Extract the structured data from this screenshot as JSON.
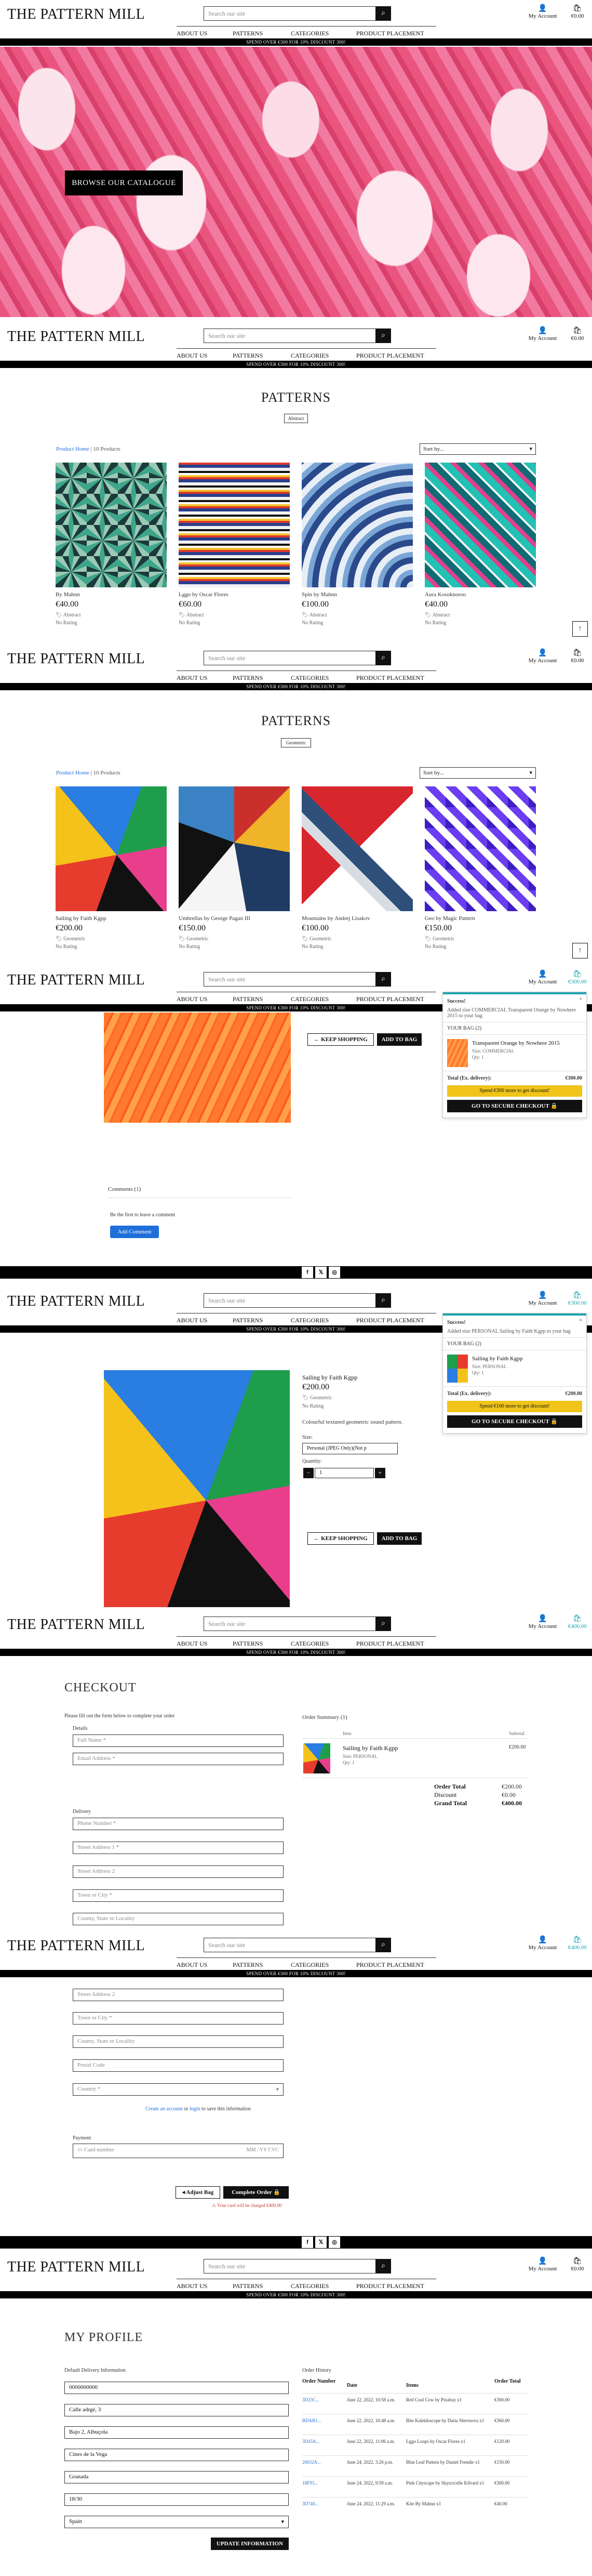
{
  "header": {
    "logo": "THE PATTERN MILL",
    "search_placeholder": "Search our site",
    "account": "My Account",
    "bag_total_empty": "€0.00",
    "bag_total_full": "€300.00",
    "bag_total_checkout": "€400.00",
    "search_icon": "search-icon",
    "account_icon": "user-icon",
    "bag_icon": "shopping-bag-icon"
  },
  "nav": {
    "about": "ABOUT US",
    "patterns": "PATTERNS",
    "categories": "CATEGORIES",
    "placement": "PRODUCT PLACEMENT"
  },
  "banner": "SPEND OVER €300 FOR 10% DISCOUNT 300!",
  "hero": {
    "button": "BROWSE OUR CATALOGUE"
  },
  "listing1": {
    "title": "PATTERNS",
    "tag": "Abstract",
    "home": "Product Home",
    "count": "| 10 Products",
    "sort": "Sort by...",
    "products": [
      {
        "name": "By Mahnn",
        "price": "€40.00",
        "category": "Abstract",
        "rating": "No Rating"
      },
      {
        "name": "Lggo by Oscar Flores",
        "price": "€60.00",
        "category": "Abstract",
        "rating": "No Rating"
      },
      {
        "name": "Spin by Mahnn",
        "price": "€100.00",
        "category": "Abstract",
        "rating": "No Rating"
      },
      {
        "name": "Aura Kosoknoroo",
        "price": "€40.00",
        "category": "Abstract",
        "rating": "No Rating"
      }
    ]
  },
  "listing2": {
    "title": "PATTERNS",
    "tag": "Geometric",
    "home": "Product Home",
    "count": "| 10 Products",
    "sort": "Sort by...",
    "products": [
      {
        "name": "Sailing by Faith Kgpp",
        "price": "€200.00",
        "category": "Geometric",
        "rating": "No Rating"
      },
      {
        "name": "Umbrellas by George Pagan III",
        "price": "€150.00",
        "category": "Geometric",
        "rating": "No Rating"
      },
      {
        "name": "Mountains by Andrej Lisakov",
        "price": "€100.00",
        "category": "Geometric",
        "rating": "No Rating"
      },
      {
        "name": "Geo by Magic Pattern",
        "price": "€150.00",
        "category": "Geometric",
        "rating": "No Rating"
      }
    ]
  },
  "pop1": {
    "ok": "Success!",
    "close": "×",
    "msg": "Added size COMMERCIAL Transparent Orange by Nowhere 2015 to your bag",
    "your_bag": "YOUR BAG (2)",
    "item": "Transparent Orange by Nowhere 2015",
    "size": "Size: COMMERCIAL",
    "qty": "Qty: 1",
    "price": "",
    "total_label": "Total (Ex. delivery):",
    "total": "€300.00",
    "spend": "Spend €300 more to get discount!",
    "checkout": "GO TO SECURE CHECKOUT 🔒"
  },
  "detail1": {
    "keep": "← KEEP SHOPPING",
    "add": "ADD TO BAG",
    "comments": "Comments (1)",
    "first": "Be the first to leave a comment",
    "add_comment": "Add Comment"
  },
  "social": [
    "f",
    "𝕏",
    "◎"
  ],
  "pop2": {
    "ok": "Success!",
    "close": "×",
    "msg": "Added size PERSONAL Sailing by Faith Kgpp to your bag",
    "your_bag": "YOUR BAG (2)",
    "item": "Sailing by Faith Kgpp",
    "size": "Size: PERSONAL",
    "qty": "Qty: 1",
    "total_label": "Total (Ex. delivery):",
    "total": "€200.00",
    "spend": "Spend €100 more to get discount!",
    "checkout": "GO TO SECURE CHECKOUT 🔒"
  },
  "detail2": {
    "name": "Sailing by Faith Kgpp",
    "price": "€200.00",
    "category": "Geometric",
    "rating": "No Rating",
    "desc": "Colourful textured geometric sound pattern.",
    "size_label": "Size:",
    "size": "Personal (JPEG Only)(Not p",
    "qty_label": "Quantity:",
    "qty": "1",
    "minus": "−",
    "plus": "+",
    "keep": "← KEEP SHOPPING",
    "add": "ADD TO BAG"
  },
  "checkout": {
    "title": "CHECKOUT",
    "intro": "Please fill out the form below to complete your order",
    "details": "Details",
    "full_name": "Full Name *",
    "email": "Email Address *",
    "delivery": "Delivery",
    "phone": "Phone Number *",
    "addr1": "Street Address 1 *",
    "addr2": "Street Address 2",
    "city": "Town or City *",
    "county": "County, State or Locality",
    "postcode": "Postal Code",
    "country": "Country *",
    "account_pre": "Create an account",
    "account_mid": " or ",
    "account_login": "login",
    "account_post": " to save this information",
    "payment": "Payment",
    "card": "Card number",
    "card_hint": "MM / YY CVC",
    "adjust": "◂ Adjust Bag",
    "complete": "Complete Order 🔒",
    "charged": "Your card will be charged €400.00",
    "summary_title": "Order Summary (1)",
    "col_item": "Item",
    "col_sub": "Subtotal",
    "item_name": "Sailing by Faith Kgpp",
    "item_size": "Size: PERSONAL",
    "item_qty": "Qty: 1",
    "item_sub": "€200.00",
    "order_total_l": "Order Total",
    "order_total": "€200.00",
    "discount_l": "Discount",
    "discount": "€0.00",
    "grand_l": "Grand Total",
    "grand": "€400.00"
  },
  "profile": {
    "title": "MY PROFILE",
    "delivery_title": "Default Delivery Information",
    "f1": "0000000000",
    "f2": "Calle adrgé, 3",
    "f3": "Bajo 2, Albuçola",
    "f4": "Cines de la Vega",
    "f5": "Granada",
    "f6": "18/30",
    "f7": "Spain",
    "update": "UPDATE INFORMATION",
    "history_title": "Order History",
    "cols": [
      "Order Number",
      "Date",
      "Items",
      "Order Total"
    ],
    "orders": [
      {
        "num": "3D23C...",
        "date": "June 22, 2022, 10:58 a.m.",
        "items": "Red Cool Cow by Pixabay x1",
        "total": "€300.00"
      },
      {
        "num": "BDAB1...",
        "date": "June 22, 2022, 10:48 a.m.",
        "items": "Bite Kaleidoscope by Daria Shevtsova x1",
        "total": "€360.00"
      },
      {
        "num": "3D43A...",
        "date": "June 22, 2022, 11:06 a.m.",
        "items": "Lggo Loops by Oscar Flores x1",
        "total": "€120.00"
      },
      {
        "num": "20632A...",
        "date": "June 24, 2022, 3:26 p.m.",
        "items": "Blue Leaf Pattern by Daniel Frendie x1",
        "total": "€150.00"
      },
      {
        "num": "18F93...",
        "date": "June 24, 2022, 9:59 a.m.",
        "items": "Pink Cityscape by Skyscrcelle Kilvard x1",
        "total": "€300.00"
      },
      {
        "num": "3D740...",
        "date": "June 24, 2022, 11:29 a.m.",
        "items": "Kite By Mahnn x1",
        "total": "€40.00"
      }
    ]
  }
}
